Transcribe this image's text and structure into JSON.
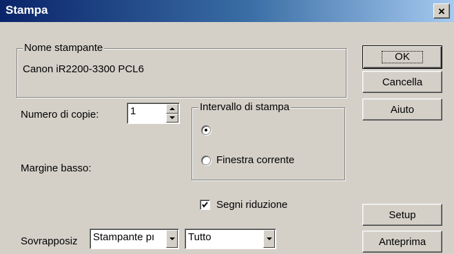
{
  "window": {
    "title": "Stampa",
    "close_symbol": "×"
  },
  "printer_group": {
    "label": "Nome stampante",
    "printer_name": "Canon iR2200-3300 PCL6"
  },
  "buttons": {
    "ok": "OK",
    "cancel": "Cancella",
    "help": "Aiuto",
    "setup": "Setup",
    "preview": "Anteprima"
  },
  "copies": {
    "label": "Numero di copie:",
    "value": "1"
  },
  "print_range": {
    "label": "Intervallo di stampa",
    "options": [
      {
        "label": "",
        "selected": true
      },
      {
        "label": "Finestra corrente",
        "selected": false
      }
    ]
  },
  "bottom_margin": {
    "label": "Margine basso:"
  },
  "crop_marks": {
    "label": "Segni riduzione",
    "checked": true
  },
  "overlay": {
    "label": "Sovrapposiz",
    "select1_value": "Stampante pı",
    "select2_value": "Tutto"
  }
}
